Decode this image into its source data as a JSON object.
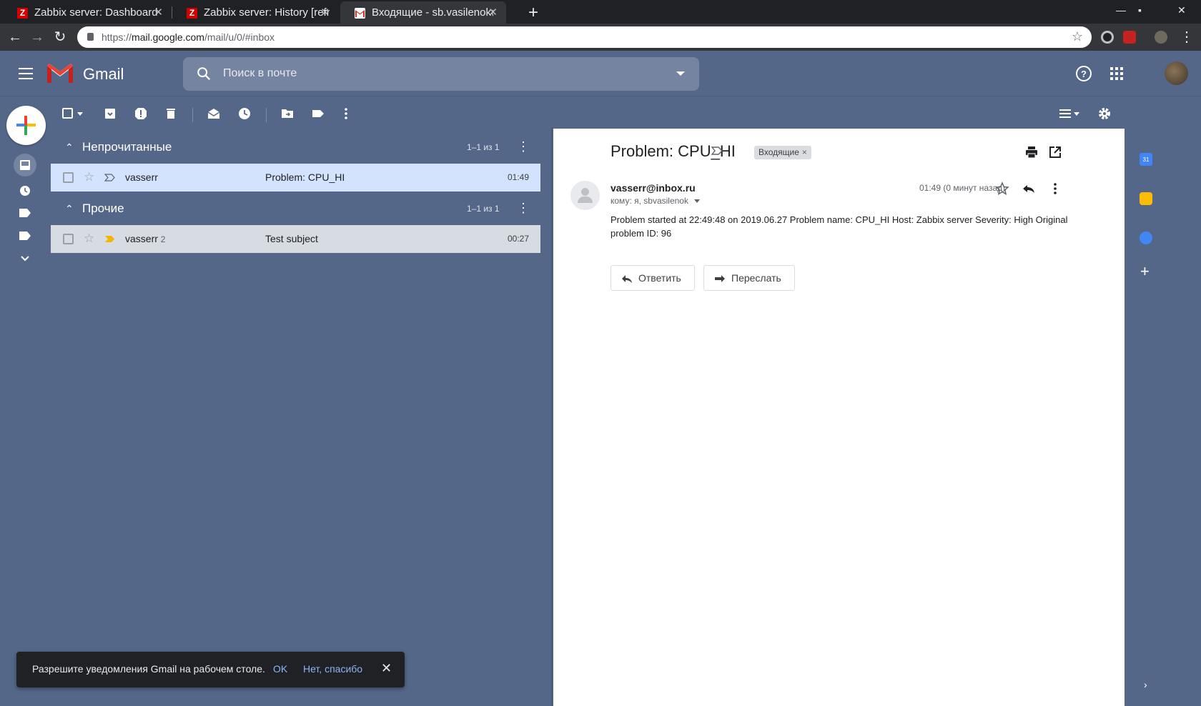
{
  "browser": {
    "tabs": [
      {
        "title": "Zabbix server: Dashboard",
        "favicon": "Z"
      },
      {
        "title": "Zabbix server: History [refr",
        "favicon": "Z"
      },
      {
        "title": "Входящие - sb.vasilenok@",
        "favicon": "gmail"
      }
    ],
    "url_prefix": "https://",
    "url_host": "mail.google.com",
    "url_path": "/mail/u/0/#inbox"
  },
  "gmail": {
    "brand": "Gmail",
    "search_placeholder": "Поиск в почте"
  },
  "sections": [
    {
      "title": "Непрочитанные",
      "count": "1–1 из 1",
      "rows": [
        {
          "sender": "vasserr",
          "thread_count": "",
          "subject": "Problem: CPU_HI",
          "time": "01:49",
          "state": "unread"
        }
      ]
    },
    {
      "title": "Прочие",
      "count": "1–1 из 1",
      "rows": [
        {
          "sender": "vasserr",
          "thread_count": "2",
          "subject": "Test subject",
          "time": "00:27",
          "state": "read"
        }
      ]
    }
  ],
  "message": {
    "subject": "Problem: CPU_HI",
    "label": "Входящие",
    "from": "vasserr@inbox.ru",
    "to": "кому: я, sbvasilenok",
    "time": "01:49 (0 минут назад)",
    "body": "Problem started at 22:49:48 on 2019.06.27 Problem name: CPU_HI Host: Zabbix server Severity: High Original problem ID: 96",
    "reply_label": "Ответить",
    "forward_label": "Переслать"
  },
  "snackbar": {
    "message": "Разрешите уведомления Gmail на рабочем столе.",
    "ok_label": "OK",
    "decline_label": "Нет, спасибо"
  },
  "colors": {
    "theme_bg": "#556788",
    "unread_row": "#d3e3fd",
    "read_row": "#d7dbe2",
    "important_marker": "#f4b400"
  }
}
